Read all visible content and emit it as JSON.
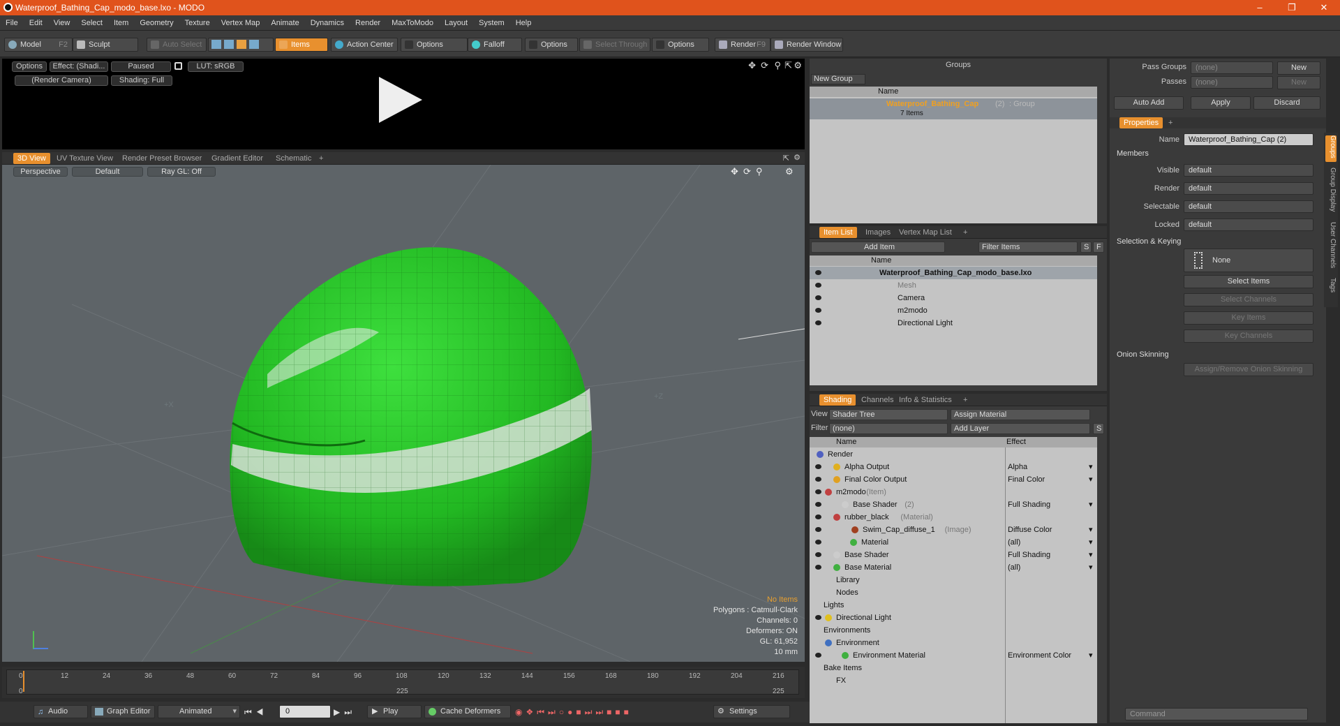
{
  "window": {
    "title": "Waterproof_Bathing_Cap_modo_base.lxo - MODO"
  },
  "menu": [
    "File",
    "Edit",
    "View",
    "Select",
    "Item",
    "Geometry",
    "Texture",
    "Vertex Map",
    "Animate",
    "Dynamics",
    "Render",
    "MaxToModo",
    "Layout",
    "System",
    "Help"
  ],
  "toolbar": {
    "model": "Model",
    "model_key": "F2",
    "sculpt": "Sculpt",
    "auto_select": "Auto Select",
    "items": "Items",
    "action_center": "Action Center",
    "options1": "Options",
    "falloff": "Falloff",
    "options2": "Options",
    "select_through": "Select Through",
    "options3": "Options",
    "render": "Render",
    "render_key": "F9",
    "render_window": "Render Window"
  },
  "preview": {
    "options": "Options",
    "effect": "Effect: (Shadi...",
    "paused": "Paused",
    "lut": "LUT: sRGB",
    "camera": "(Render Camera)",
    "shading": "Shading: Full"
  },
  "viewport_tabs": [
    "3D View",
    "UV Texture View",
    "Render Preset Browser",
    "Gradient Editor",
    "Schematic",
    "+"
  ],
  "viewport": {
    "perspective": "Perspective",
    "default": "Default",
    "raygl": "Ray GL: Off",
    "axis_x": "+X",
    "axis_z": "+Z"
  },
  "stats": {
    "no_items": "No Items",
    "polygons": "Polygons : Catmull-Clark",
    "channels": "Channels: 0",
    "deformers": "Deformers: ON",
    "gl": "GL: 61,952",
    "unit": "10 mm"
  },
  "timeline": {
    "ticks": [
      "0",
      "12",
      "24",
      "36",
      "48",
      "60",
      "72",
      "84",
      "96",
      "108",
      "120",
      "132",
      "144",
      "156",
      "168",
      "180",
      "192",
      "204",
      "216"
    ],
    "start": "0",
    "mid": "225",
    "end": "225"
  },
  "bottombar": {
    "audio": "Audio",
    "graph_editor": "Graph Editor",
    "animated": "Animated",
    "frame": "0",
    "play": "Play",
    "cache": "Cache Deformers",
    "settings": "Settings"
  },
  "groups": {
    "title": "Groups",
    "new_group": "New Group",
    "col_name": "Name",
    "group_name": "Waterproof_Bathing_Cap",
    "group_count": "(2)",
    "group_type": ": Group",
    "group_items": "7 Items"
  },
  "itemlist": {
    "tabs": [
      "Item List",
      "Images",
      "Vertex Map List",
      "+"
    ],
    "add_item": "Add Item",
    "filter": "Filter Items",
    "s": "S",
    "f": "F",
    "col_name": "Name",
    "rows": [
      {
        "label": "Waterproof_Bathing_Cap_modo_base.lxo"
      },
      {
        "label": "Mesh"
      },
      {
        "label": "Camera"
      },
      {
        "label": "m2modo"
      },
      {
        "label": "Directional Light"
      }
    ]
  },
  "shading": {
    "tabs": [
      "Shading",
      "Channels",
      "Info & Statistics",
      "+"
    ],
    "view_label": "View",
    "view_value": "Shader Tree",
    "assign": "Assign Material",
    "filter_label": "Filter",
    "filter_value": "(none)",
    "add_layer": "Add Layer",
    "s": "S",
    "col_name": "Name",
    "col_effect": "Effect",
    "rows": [
      {
        "name": "Render",
        "note": "",
        "effect": ""
      },
      {
        "name": "Alpha Output",
        "note": "",
        "effect": "Alpha"
      },
      {
        "name": "Final Color Output",
        "note": "",
        "effect": "Final Color"
      },
      {
        "name": "m2modo",
        "note": "(Item)",
        "effect": ""
      },
      {
        "name": "Base Shader",
        "note": "(2)",
        "effect": "Full Shading"
      },
      {
        "name": "rubber_black",
        "note": "(Material)",
        "effect": ""
      },
      {
        "name": "Swim_Cap_diffuse_1",
        "note": "(Image)",
        "effect": "Diffuse Color"
      },
      {
        "name": "Material",
        "note": "",
        "effect": "(all)"
      },
      {
        "name": "Base Shader",
        "note": "",
        "effect": "Full Shading"
      },
      {
        "name": "Base Material",
        "note": "",
        "effect": "(all)"
      },
      {
        "name": "Library",
        "note": "",
        "effect": ""
      },
      {
        "name": "Nodes",
        "note": "",
        "effect": ""
      },
      {
        "name": "Lights",
        "note": "",
        "effect": ""
      },
      {
        "name": "Directional Light",
        "note": "",
        "effect": ""
      },
      {
        "name": "Environments",
        "note": "",
        "effect": ""
      },
      {
        "name": "Environment",
        "note": "",
        "effect": ""
      },
      {
        "name": "Environment Material",
        "note": "",
        "effect": "Environment Color"
      },
      {
        "name": "Bake Items",
        "note": "",
        "effect": ""
      },
      {
        "name": "FX",
        "note": "",
        "effect": ""
      }
    ]
  },
  "passes": {
    "pass_groups": "Pass Groups",
    "passes": "Passes",
    "none1": "(none)",
    "none2": "(none)",
    "new1": "New",
    "new2": "New",
    "auto_add": "Auto Add",
    "apply": "Apply",
    "discard": "Discard"
  },
  "properties": {
    "tab": "Properties",
    "plus": "+",
    "name_label": "Name",
    "name_value": "Waterproof_Bathing_Cap (2)",
    "members": "Members",
    "visible": "Visible",
    "render": "Render",
    "selectable": "Selectable",
    "locked": "Locked",
    "default": "default",
    "sel_keying": "Selection & Keying",
    "none": "None",
    "select_items": "Select Items",
    "select_channels": "Select Channels",
    "key_items": "Key Items",
    "key_channels": "Key Channels",
    "onion": "Onion Skinning",
    "assign_onion": "Assign/Remove Onion Skinning",
    "command": "Command"
  },
  "side_tabs": [
    "Groups",
    "Group Display",
    "User Channels",
    "Tags"
  ]
}
